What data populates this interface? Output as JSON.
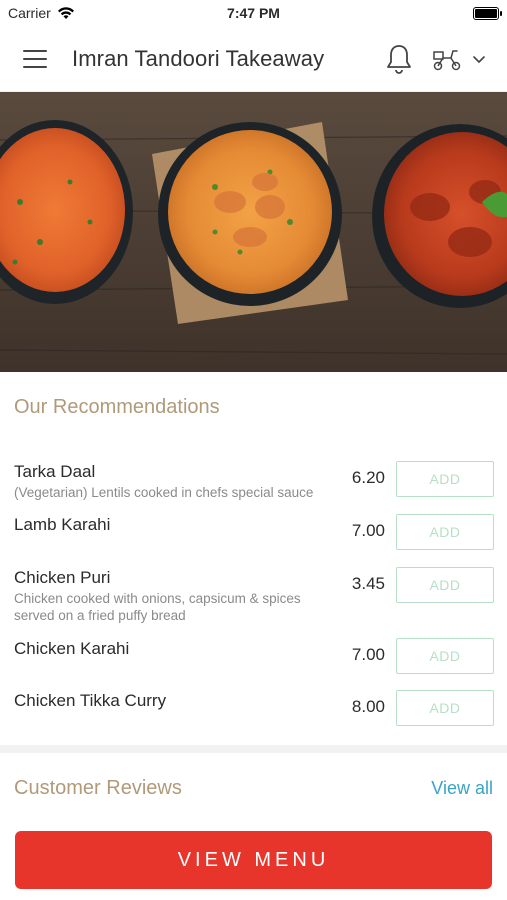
{
  "status_bar": {
    "carrier": "Carrier",
    "time": "7:47 PM"
  },
  "header": {
    "title": "Imran Tandoori Takeaway"
  },
  "recommendations": {
    "title": "Our Recommendations",
    "add_label": "ADD",
    "items": [
      {
        "name": "Tarka Daal",
        "description": "(Vegetarian) Lentils cooked in chefs special sauce",
        "price": "6.20"
      },
      {
        "name": "Lamb Karahi",
        "description": "",
        "price": "7.00"
      },
      {
        "name": "Chicken Puri",
        "description": "Chicken cooked with onions, capsicum & spices served on a fried puffy bread",
        "price": "3.45"
      },
      {
        "name": "Chicken Karahi",
        "description": "",
        "price": "7.00"
      },
      {
        "name": "Chicken Tikka Curry",
        "description": "",
        "price": "8.00"
      }
    ]
  },
  "reviews": {
    "title": "Customer Reviews",
    "view_all_label": "View all"
  },
  "footer": {
    "view_menu_label": "VIEW MENU"
  },
  "colors": {
    "accent_red": "#e8352b",
    "section_title": "#b09a7a",
    "add_border": "#b7e0c7",
    "link": "#3aa3c9"
  }
}
